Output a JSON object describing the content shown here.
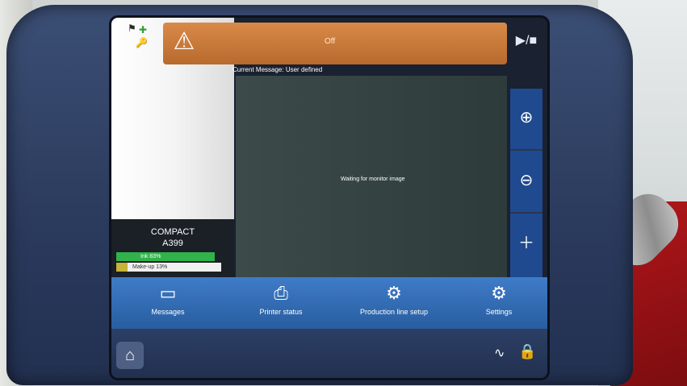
{
  "alert": {
    "text": "Off"
  },
  "message": {
    "current_label": "Current Message:",
    "current_value": "User defined",
    "status_text": "Waiting for monitor image"
  },
  "printer": {
    "name": "COMPACT",
    "model": "A399",
    "ink_text": "Ink 83%",
    "makeup_text": "Make-up 13%"
  },
  "nav": {
    "messages": "Messages",
    "printer_status": "Printer status",
    "production_line_setup": "Production line setup",
    "settings": "Settings"
  },
  "icons": {
    "warning": "warning-icon",
    "play_stop": "play-stop-icon",
    "zoom_in": "zoom-in-icon",
    "zoom_out": "zoom-out-icon",
    "add_doc": "add-document-icon",
    "home": "home-icon",
    "heartbeat": "heartbeat-icon",
    "lock": "lock-icon"
  },
  "colors": {
    "alert": "#d98a48",
    "nav_blue": "#3f7cc8",
    "ink_green": "#2fb34a"
  }
}
